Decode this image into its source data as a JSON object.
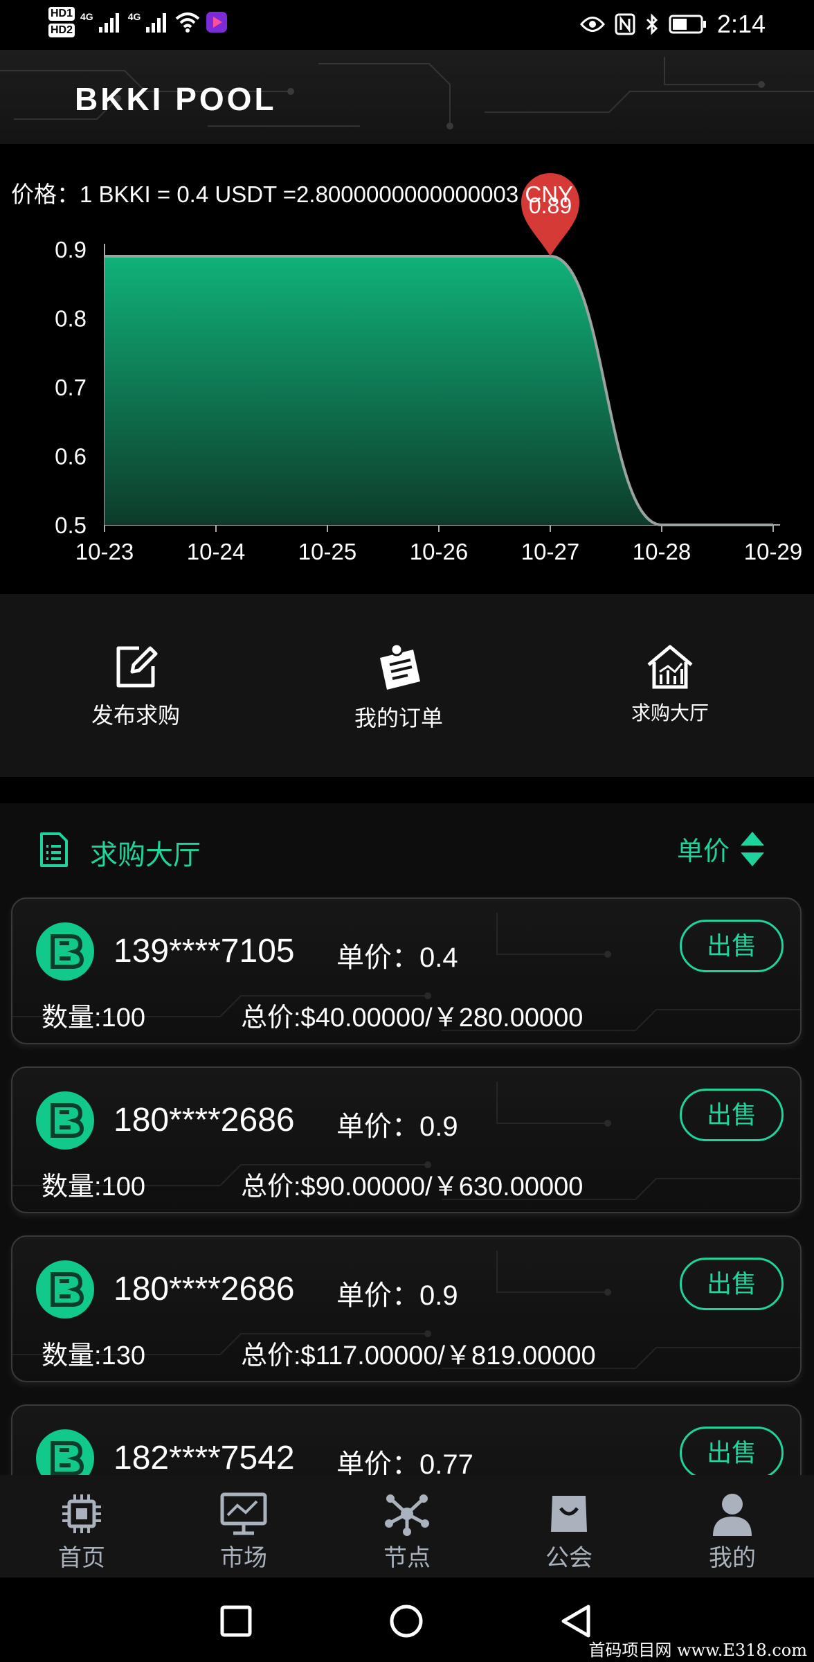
{
  "status_bar": {
    "hd1": "HD1",
    "hd2": "HD2",
    "net1": "4G",
    "net2": "4G",
    "time": "2:14"
  },
  "header": {
    "title": "BKKI POOL"
  },
  "price": {
    "text": "价格：1 BKKI = 0.4 USDT =2.8000000000000003 CNY"
  },
  "chart_data": {
    "type": "area",
    "x": [
      "10-23",
      "10-24",
      "10-25",
      "10-26",
      "10-27",
      "10-28",
      "10-29"
    ],
    "values": [
      0.89,
      0.89,
      0.89,
      0.89,
      0.89,
      0.5,
      0.5
    ],
    "y_ticks": [
      "0.9",
      "0.8",
      "0.7",
      "0.6",
      "0.5"
    ],
    "ylim": [
      0.5,
      0.9
    ],
    "marker": {
      "x": "10-27",
      "label": "0.89"
    },
    "colors": {
      "fill_top": "#10b27a",
      "fill_bottom": "#0d3b2a",
      "line": "#9aa39f",
      "marker": "#d63a36"
    }
  },
  "actions": [
    {
      "label": "发布求购",
      "icon": "edit-icon"
    },
    {
      "label": "我的订单",
      "icon": "orders-icon"
    },
    {
      "label": "求购大厅",
      "icon": "hall-icon"
    }
  ],
  "hall": {
    "title": "求购大厅",
    "sort_label": "单价",
    "accent": "#1fd49c"
  },
  "orders": [
    {
      "user": "139****7105",
      "unit_price": "单价：0.4",
      "qty": "数量:100",
      "total": "总价:$40.00000/￥280.00000",
      "sell": "出售"
    },
    {
      "user": "180****2686",
      "unit_price": "单价：0.9",
      "qty": "数量:100",
      "total": "总价:$90.00000/￥630.00000",
      "sell": "出售"
    },
    {
      "user": "180****2686",
      "unit_price": "单价：0.9",
      "qty": "数量:130",
      "total": "总价:$117.00000/￥819.00000",
      "sell": "出售"
    },
    {
      "user": "182****7542",
      "unit_price": "单价：0.77",
      "qty": "",
      "total": "",
      "sell": "出售"
    }
  ],
  "nav": [
    {
      "label": "首页",
      "icon": "chip-icon"
    },
    {
      "label": "市场",
      "icon": "market-icon"
    },
    {
      "label": "节点",
      "icon": "node-icon"
    },
    {
      "label": "公会",
      "icon": "guild-bag-icon"
    },
    {
      "label": "我的",
      "icon": "profile-icon"
    }
  ],
  "watermark": "首码项目网 www.E318.com"
}
